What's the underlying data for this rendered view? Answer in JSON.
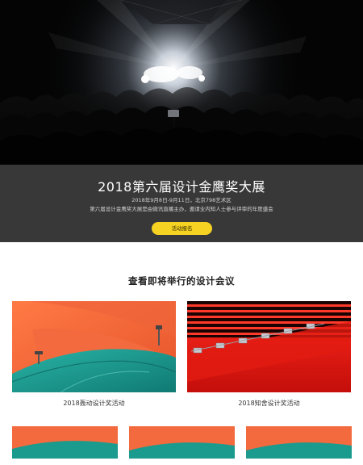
{
  "hero": {
    "title": "2018第六届设计金鹰奖大展",
    "date_location": "2018年9月8日-9月11日，北京798艺术区",
    "description": "第六届设计金鹰奖大展是由微讯直播主办，邀请业内知人士参与评审的年度盛会",
    "cta_label": "活动报名",
    "accent_color": "#f6d222"
  },
  "section": {
    "heading": "查看即将举行的设计会议"
  },
  "events": [
    {
      "caption": "2018轰动设计奖活动"
    },
    {
      "caption": "2018知舍设计奖活动"
    },
    {
      "caption": ""
    },
    {
      "caption": ""
    },
    {
      "caption": ""
    }
  ]
}
